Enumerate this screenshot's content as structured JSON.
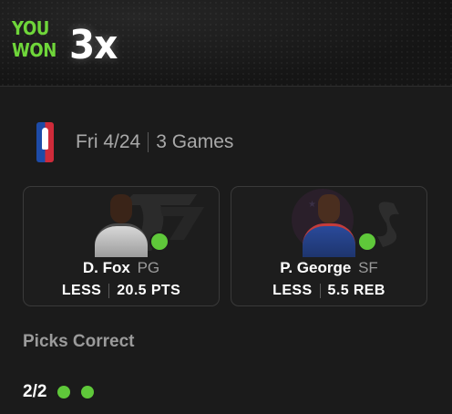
{
  "result": {
    "line1": "YOU",
    "line2": "WON",
    "multiplier": "3x",
    "accent_color": "#6fd63a"
  },
  "game": {
    "league_icon": "nba-logo-icon",
    "date": "Fri 4/24",
    "games": "3 Games"
  },
  "picks": [
    {
      "name": "D. Fox",
      "position": "PG",
      "direction": "LESS",
      "line": "20.5 PTS",
      "status": "hit",
      "status_color": "#5fc83a",
      "team_art": "spurs-logo-icon"
    },
    {
      "name": "P. George",
      "position": "SF",
      "direction": "LESS",
      "line": "5.5 REB",
      "status": "hit",
      "status_color": "#5fc83a",
      "team_art": "76ers-logo-icon"
    }
  ],
  "summary": {
    "title": "Picks Correct",
    "value": "2/2",
    "dots": [
      "correct",
      "correct"
    ]
  }
}
